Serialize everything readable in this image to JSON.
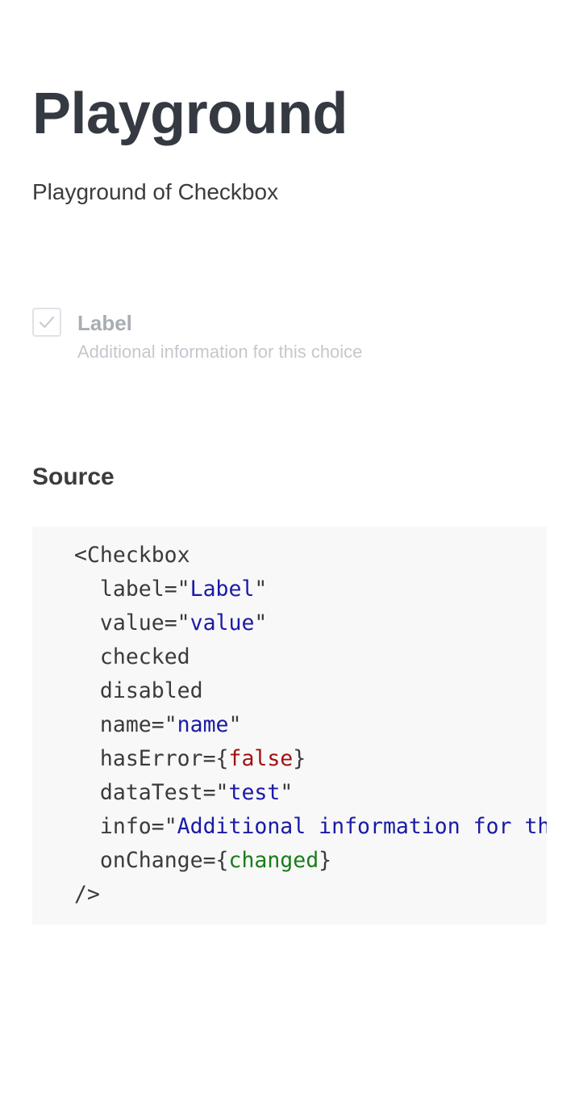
{
  "header": {
    "title": "Playground",
    "subtitle": "Playground of Checkbox"
  },
  "checkbox": {
    "label": "Label",
    "info": "Additional information for this choice",
    "checked": true,
    "disabled": true,
    "icon": "check-icon"
  },
  "source": {
    "title": "Source",
    "lines": [
      {
        "open": "<Checkbox"
      },
      {
        "prop": "label",
        "eq": "=\"",
        "value": "Label",
        "close": "\""
      },
      {
        "prop": "value",
        "eq": "=\"",
        "value": "value",
        "close": "\""
      },
      {
        "prop": "checked"
      },
      {
        "prop": "disabled"
      },
      {
        "prop": "name",
        "eq": "=\"",
        "value": "name",
        "close": "\""
      },
      {
        "prop": "hasError",
        "eq": "={",
        "value": "false",
        "close": "}"
      },
      {
        "prop": "dataTest",
        "eq": "=\"",
        "value": "test",
        "close": "\""
      },
      {
        "prop": "info",
        "eq": "=\"",
        "value": "Additional information for this choice",
        "close": "\""
      },
      {
        "prop": "onChange",
        "eq": "={",
        "value": "changed",
        "close": "}"
      },
      {
        "end": "/>"
      }
    ]
  },
  "colors": {
    "string": "#1a1aa6",
    "boolean": "#a11111",
    "function": "#1a7d1a",
    "code_background": "#f8f8f8"
  }
}
